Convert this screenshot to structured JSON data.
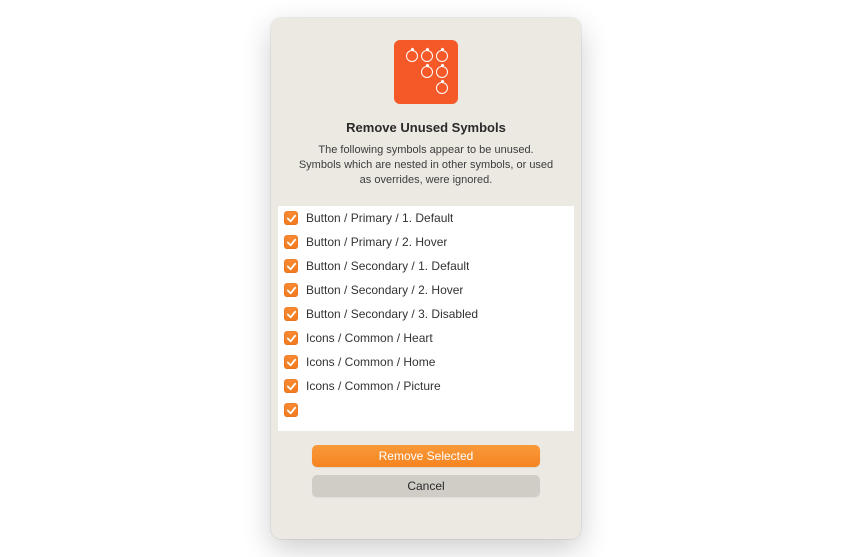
{
  "dialog": {
    "title": "Remove Unused Symbols",
    "description": "The following symbols appear to be unused. Symbols which are nested in other symbols, or used as overrides, were ignored.",
    "primary_label": "Remove Selected",
    "secondary_label": "Cancel"
  },
  "symbols": [
    {
      "checked": true,
      "name": "Button / Primary / 1. Default"
    },
    {
      "checked": true,
      "name": "Button / Primary / 2. Hover"
    },
    {
      "checked": true,
      "name": "Button / Secondary / 1. Default"
    },
    {
      "checked": true,
      "name": "Button / Secondary / 2. Hover"
    },
    {
      "checked": true,
      "name": "Button / Secondary / 3. Disabled"
    },
    {
      "checked": true,
      "name": "Icons / Common / Heart"
    },
    {
      "checked": true,
      "name": "Icons / Common / Home"
    },
    {
      "checked": true,
      "name": "Icons / Common / Picture"
    }
  ],
  "colors": {
    "accent": "#f58420",
    "icon_bg": "#f55927"
  }
}
